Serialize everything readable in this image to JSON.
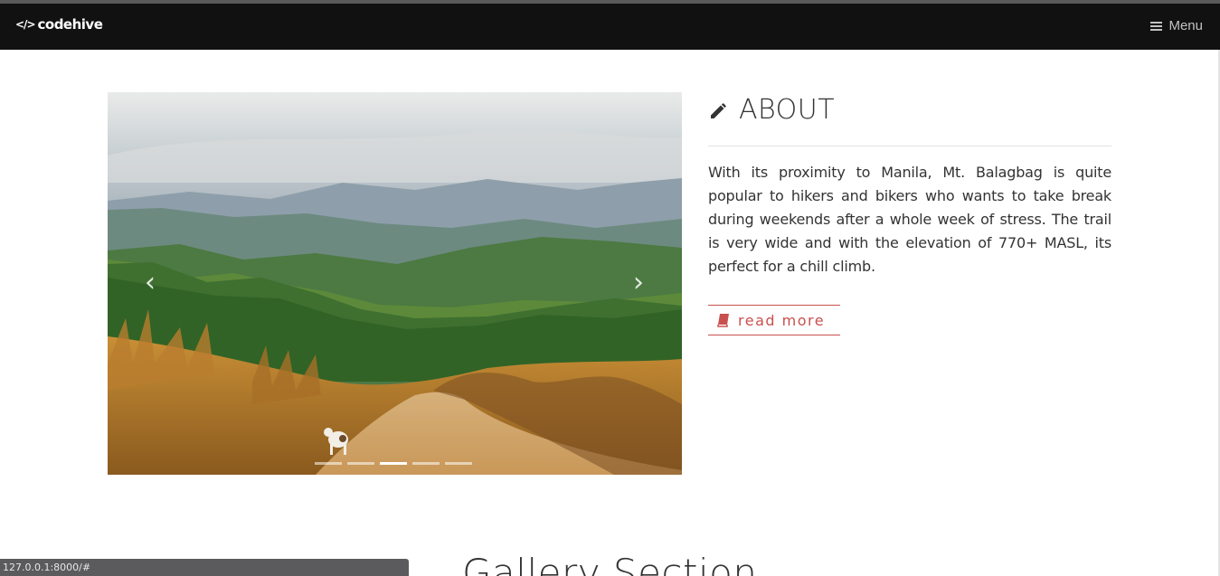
{
  "navbar": {
    "brand_icon": "</>",
    "brand": "codehive",
    "menu_label": "Menu",
    "menu_icon": "hamburger-icon"
  },
  "carousel": {
    "slide_count": 5,
    "active_index": 2,
    "prev_icon": "chevron-left-icon",
    "next_icon": "chevron-right-icon"
  },
  "about": {
    "title": "ABOUT",
    "title_icon": "pencil-icon",
    "text": "With its proximity to Manila, Mt. Balagbag is quite popular to hikers and bikers who wants to take break during weekends after a whole week of stress. The trail is very wide and with the elevation of 770+ MASL, its perfect for a chill climb.",
    "read_more_label": "read more",
    "read_more_icon": "book-icon"
  },
  "gallery": {
    "title": "Gallery Section"
  },
  "status_bar": {
    "url": "127.0.0.1:8000/#"
  },
  "colors": {
    "navbar_bg": "#111111",
    "accent": "#c9504e",
    "text": "#333333"
  }
}
